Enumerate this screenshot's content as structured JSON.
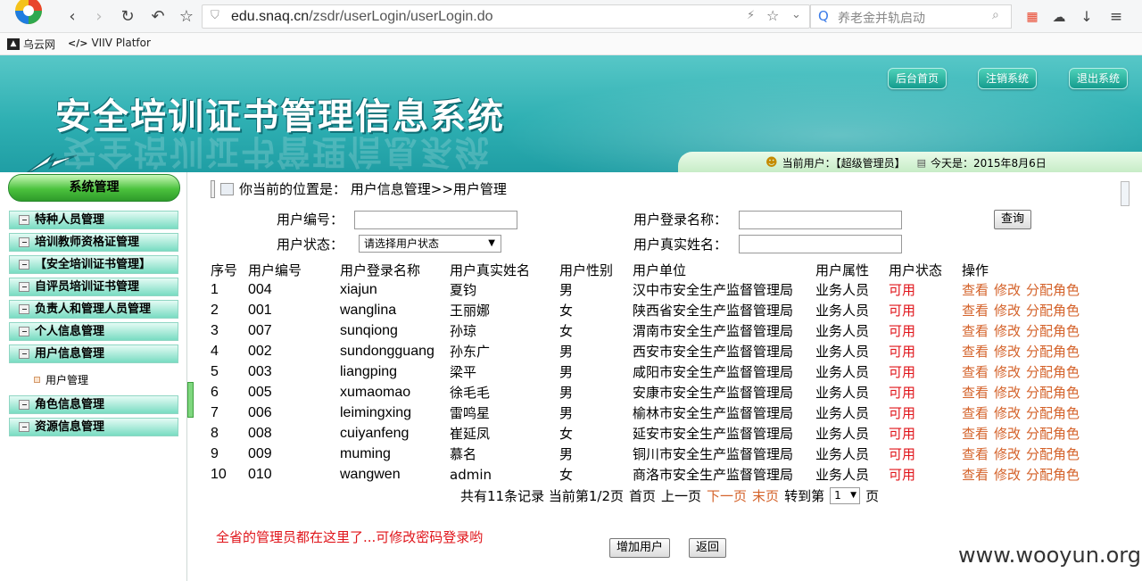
{
  "browser": {
    "url_host": "edu.snaq.cn",
    "url_path": "/zsdr/userLogin/userLogin.do",
    "search_text": "养老金并轨启动",
    "bookmarks": [
      {
        "label": "乌云网"
      },
      {
        "label": "VIIV Platfor"
      }
    ]
  },
  "header": {
    "title": "安全培训证书管理信息系统",
    "buttons": {
      "home": "后台首页",
      "logout": "注销系统",
      "exit": "退出系统"
    },
    "current_user": "当前用户：【超级管理员】",
    "today": "今天是：2015年8月6日"
  },
  "sidebar": {
    "title": "系统管理",
    "items": [
      {
        "label": "特种人员管理"
      },
      {
        "label": "培训教师资格证管理"
      },
      {
        "label": "【安全培训证书管理】"
      },
      {
        "label": "自评员培训证书管理"
      },
      {
        "label": "负责人和管理人员管理"
      },
      {
        "label": "个人信息管理"
      },
      {
        "label": "用户信息管理"
      }
    ],
    "sub_item": "用户管理",
    "items_after": [
      {
        "label": "角色信息管理"
      },
      {
        "label": "资源信息管理"
      }
    ]
  },
  "main": {
    "breadcrumb": "你当前的位置是： 用户信息管理>>用户管理",
    "filters": {
      "user_id_label": "用户编号：",
      "login_name_label": "用户登录名称：",
      "status_label": "用户状态：",
      "status_value": "请选择用户状态",
      "real_name_label": "用户真实姓名：",
      "query_button": "查询"
    },
    "table": {
      "headers": [
        "序号",
        "用户编号",
        "用户登录名称",
        "用户真实姓名",
        "用户性别",
        "用户单位",
        "用户属性",
        "用户状态",
        "操作"
      ],
      "rows": [
        {
          "no": "1",
          "id": "004",
          "login": "xiajun",
          "name": "夏钧",
          "gender": "男",
          "unit": "汉中市安全生产监督管理局",
          "attr": "业务人员",
          "status": "可用"
        },
        {
          "no": "2",
          "id": "001",
          "login": "wanglina",
          "name": "王丽娜",
          "gender": "女",
          "unit": "陕西省安全生产监督管理局",
          "attr": "业务人员",
          "status": "可用"
        },
        {
          "no": "3",
          "id": "007",
          "login": "sunqiong",
          "name": "孙琼",
          "gender": "女",
          "unit": "渭南市安全生产监督管理局",
          "attr": "业务人员",
          "status": "可用"
        },
        {
          "no": "4",
          "id": "002",
          "login": "sundongguang",
          "name": "孙东广",
          "gender": "男",
          "unit": "西安市安全生产监督管理局",
          "attr": "业务人员",
          "status": "可用"
        },
        {
          "no": "5",
          "id": "003",
          "login": "liangping",
          "name": "梁平",
          "gender": "男",
          "unit": "咸阳市安全生产监督管理局",
          "attr": "业务人员",
          "status": "可用"
        },
        {
          "no": "6",
          "id": "005",
          "login": "xumaomao",
          "name": "徐毛毛",
          "gender": "男",
          "unit": "安康市安全生产监督管理局",
          "attr": "业务人员",
          "status": "可用"
        },
        {
          "no": "7",
          "id": "006",
          "login": "leimingxing",
          "name": "雷鸣星",
          "gender": "男",
          "unit": "榆林市安全生产监督管理局",
          "attr": "业务人员",
          "status": "可用"
        },
        {
          "no": "8",
          "id": "008",
          "login": "cuiyanfeng",
          "name": "崔延凤",
          "gender": "女",
          "unit": "延安市安全生产监督管理局",
          "attr": "业务人员",
          "status": "可用"
        },
        {
          "no": "9",
          "id": "009",
          "login": "muming",
          "name": "慕名",
          "gender": "男",
          "unit": "铜川市安全生产监督管理局",
          "attr": "业务人员",
          "status": "可用"
        },
        {
          "no": "10",
          "id": "010",
          "login": "wangwen",
          "name": "admin",
          "gender": "女",
          "unit": "商洛市安全生产监督管理局",
          "attr": "业务人员",
          "status": "可用"
        }
      ],
      "ops": {
        "view": "查看",
        "edit": "修改",
        "assign": "分配角色"
      }
    },
    "pager": {
      "summary": "共有11条记录 当前第1/2页",
      "first": "首页",
      "prev": "上一页",
      "next": "下一页",
      "last": "末页",
      "goto": "转到第",
      "page_value": "1",
      "page_suffix": "页"
    },
    "note": "全省的管理员都在这里了...可修改密码登录哟",
    "add_button": "增加用户",
    "back_button": "返回"
  },
  "watermark": "www.wooyun.org"
}
